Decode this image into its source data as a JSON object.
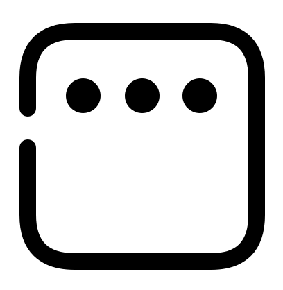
{
  "icon": {
    "name": "more-options-icon",
    "stroke_color": "#000000",
    "background_color": "#ffffff",
    "dot_count": 3
  }
}
